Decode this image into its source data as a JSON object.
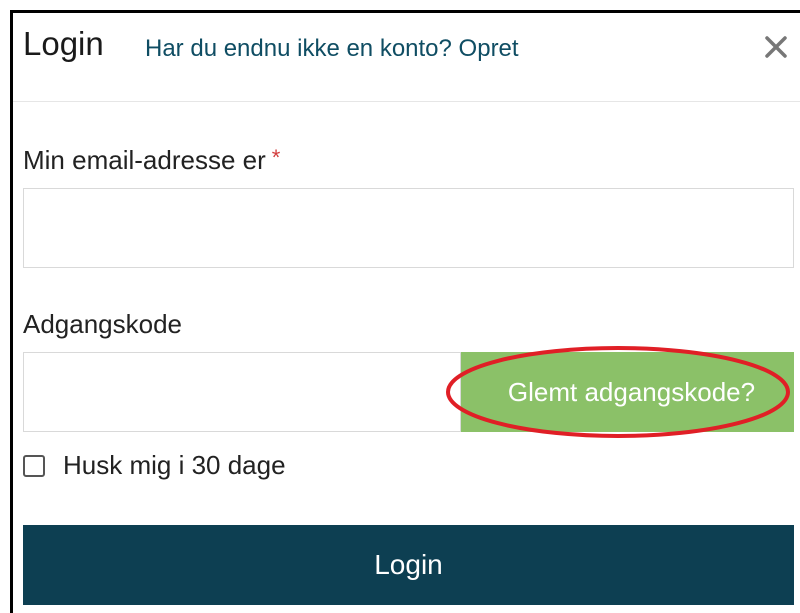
{
  "header": {
    "title": "Login",
    "signup_link": "Har du endnu ikke en konto? Opret",
    "close_icon": "close-icon"
  },
  "form": {
    "email_label": "Min email-adresse er",
    "required_marker": "*",
    "email_value": "",
    "password_label": "Adgangskode",
    "password_value": "",
    "forgot_label": "Glemt adgangskode?",
    "remember_label": "Husk mig i 30 dage",
    "remember_checked": false,
    "submit_label": "Login"
  },
  "colors": {
    "accent_green": "#8bc168",
    "primary_dark": "#0d3f52",
    "link": "#0f4d63",
    "required": "#d23c3c",
    "annotation_red": "#e01f26"
  }
}
